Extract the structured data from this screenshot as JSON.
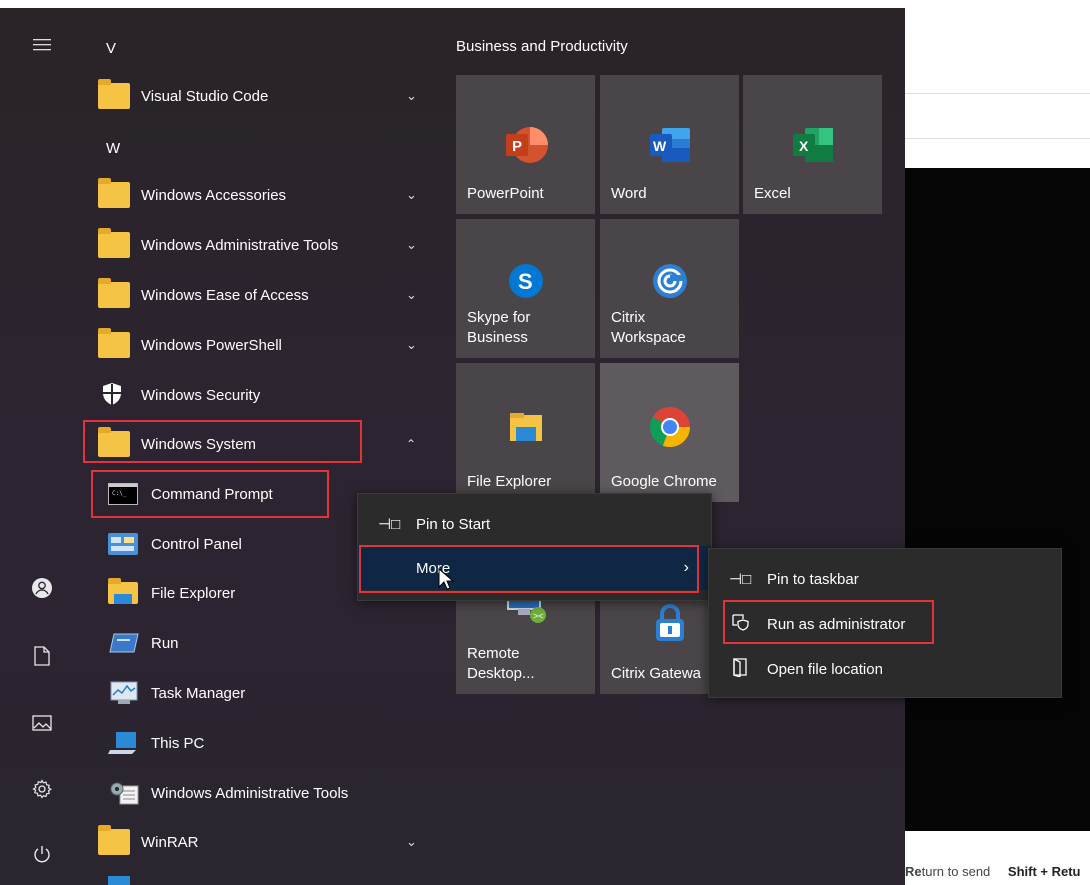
{
  "background_app": {
    "footer_send": "turn to send",
    "footer_return": "Re",
    "footer_shift": "Shift + Retu"
  },
  "rail": {
    "menu_icon": "hamburger-icon",
    "user_icon": "user-icon",
    "documents_icon": "document-icon",
    "pictures_icon": "pictures-icon",
    "settings_icon": "gear-icon",
    "power_icon": "power-icon"
  },
  "app_list": {
    "letter_v": "V",
    "letter_w": "W",
    "items": [
      {
        "label": "Visual Studio Code"
      },
      {
        "label": "Windows Accessories"
      },
      {
        "label": "Windows Administrative Tools"
      },
      {
        "label": "Windows Ease of Access"
      },
      {
        "label": "Windows PowerShell"
      },
      {
        "label": "Windows Security"
      },
      {
        "label": "Windows System"
      },
      {
        "label": "Command Prompt"
      },
      {
        "label": "Control Panel"
      },
      {
        "label": "File Explorer"
      },
      {
        "label": "Run"
      },
      {
        "label": "Task Manager"
      },
      {
        "label": "This PC"
      },
      {
        "label": "Windows Administrative Tools"
      },
      {
        "label": "WinRAR"
      }
    ]
  },
  "tiles": {
    "group_title": "Business and Productivity",
    "powerpoint": "PowerPoint",
    "word": "Word",
    "excel": "Excel",
    "skype_1": "Skype for",
    "skype_2": "Business",
    "citrix_1": "Citrix",
    "citrix_2": "Workspace",
    "file_explorer": "File Explorer",
    "chrome": "Google Chrome",
    "remote_1": "Remote",
    "remote_2": "Desktop...",
    "citrix_gateway": "Citrix Gatewa"
  },
  "context_menu": {
    "pin_to_start": "Pin to Start",
    "more": "More"
  },
  "sub_menu": {
    "pin_to_taskbar": "Pin to taskbar",
    "run_as_admin": "Run as administrator",
    "open_file_location": "Open file location"
  },
  "colors": {
    "highlight_border": "#e0343a",
    "menu_bg": "#2b2b2b",
    "more_hover": "#0f2744",
    "folder": "#f6c445"
  }
}
